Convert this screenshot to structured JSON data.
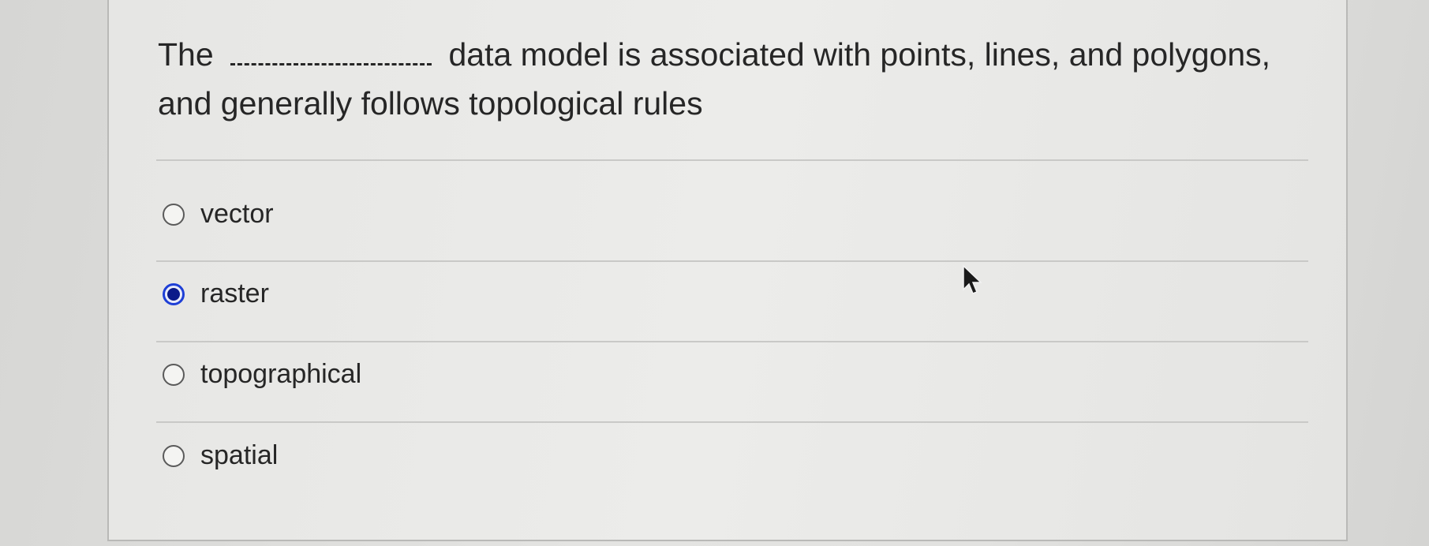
{
  "question": {
    "text_before_blank": "The",
    "text_after_blank": "data model is associated with points, lines, and polygons, and generally follows topological rules"
  },
  "options": [
    {
      "label": "vector",
      "selected": false
    },
    {
      "label": "raster",
      "selected": true
    },
    {
      "label": "topographical",
      "selected": false
    },
    {
      "label": "spatial",
      "selected": false
    }
  ],
  "colors": {
    "selected_radio": "#1e3fd6",
    "selected_dot": "#0b1a8a"
  },
  "icons": {
    "cursor": "arrow-cursor-icon"
  }
}
